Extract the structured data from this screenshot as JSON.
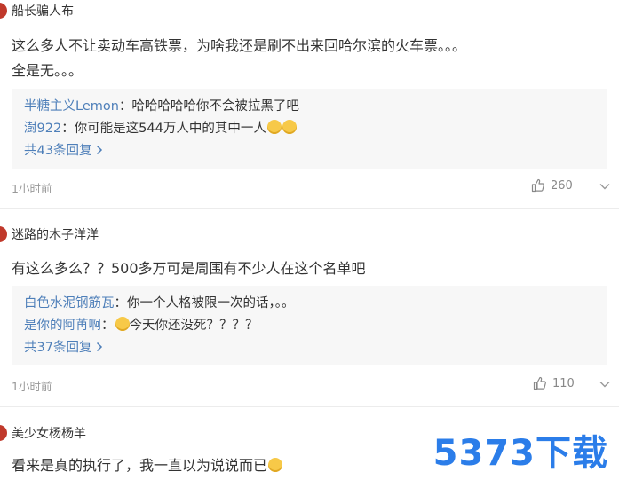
{
  "comments": [
    {
      "username": "船长骗人布",
      "content": "这么多人不让卖动车高铁票，为啥我还是刷不出来回哈尔滨的火车票。。。",
      "content_line2": "全是无。。。",
      "replies": [
        {
          "user": "半糖主义Lemon",
          "text": "：哈哈哈哈哈你不会被拉黑了吧"
        },
        {
          "user": "澍922",
          "text": "：你可能是这544万人中的其中一人"
        }
      ],
      "more_replies": "共43条回复",
      "time": "1小时前",
      "likes": "260"
    },
    {
      "username": "迷路的木子洋洋",
      "content": "有这么多么？？500多万可是周围有不少人在这个名单吧",
      "replies": [
        {
          "user": "白色水泥钢筋瓦",
          "text": "：你一个人格被限一次的话，。。"
        },
        {
          "user": "是你的阿苒啊",
          "text": "：",
          "text_after": "今天你还没死？？？？"
        }
      ],
      "more_replies": "共37条回复",
      "time": "1小时前",
      "likes": "110"
    },
    {
      "username": "美少女杨杨羊",
      "content": "看来是真的执行了，我一直以为说说而已"
    }
  ],
  "watermark": "5373下载",
  "colors": {
    "link": "#4e7fb9",
    "reply_bg": "#f7f7f7",
    "meta_text": "#999999",
    "watermark": "#2b7de9"
  },
  "icons": {
    "like": "thumbs-up-icon",
    "more": "chevron-down-icon",
    "expand": "chevron-right-icon",
    "emoji": "emoji-icon"
  }
}
